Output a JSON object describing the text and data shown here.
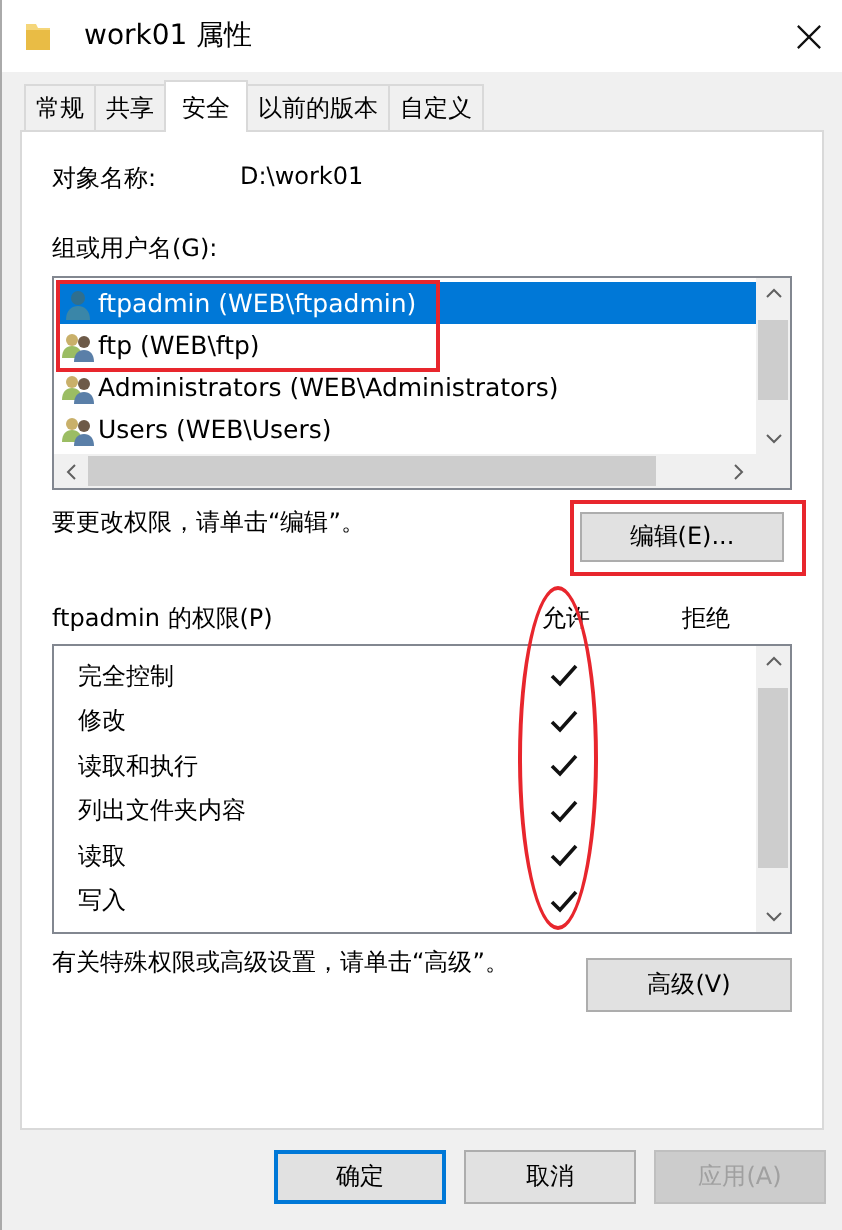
{
  "window": {
    "title": "work01 属性"
  },
  "tabs": [
    {
      "label": "常规",
      "selected": false
    },
    {
      "label": "共享",
      "selected": false
    },
    {
      "label": "安全",
      "selected": true
    },
    {
      "label": "以前的版本",
      "selected": false
    },
    {
      "label": "自定义",
      "selected": false
    }
  ],
  "object_name": {
    "label": "对象名称:",
    "value": "D:\\work01"
  },
  "users": {
    "label": "组或用户名(G):",
    "items": [
      {
        "name": "ftpadmin (WEB\\ftpadmin)",
        "kind": "user",
        "selected": true,
        "circled": true
      },
      {
        "name": "ftp (WEB\\ftp)",
        "kind": "group",
        "selected": false,
        "circled": true
      },
      {
        "name": "Administrators (WEB\\Administrators)",
        "kind": "group",
        "selected": false,
        "circled": false
      },
      {
        "name": "Users (WEB\\Users)",
        "kind": "group",
        "selected": false,
        "circled": false
      }
    ]
  },
  "edit_hint": "要更改权限，请单击“编辑”。",
  "edit_button": {
    "label": "编辑(E)...",
    "circled": true
  },
  "permissions": {
    "label": "ftpadmin 的权限(P)",
    "allow_header": "允许",
    "deny_header": "拒绝",
    "allow_column_circled": true,
    "items": [
      {
        "name": "完全控制",
        "allow": true,
        "deny": false
      },
      {
        "name": "修改",
        "allow": true,
        "deny": false
      },
      {
        "name": "读取和执行",
        "allow": true,
        "deny": false
      },
      {
        "name": "列出文件夹内容",
        "allow": true,
        "deny": false
      },
      {
        "name": "读取",
        "allow": true,
        "deny": false
      },
      {
        "name": "写入",
        "allow": true,
        "deny": false
      }
    ]
  },
  "advanced_hint": "有关特殊权限或高级设置，请单击“高级”。",
  "advanced_button": {
    "label": "高级(V)"
  },
  "buttons": [
    {
      "label": "确定",
      "default": true,
      "disabled": false
    },
    {
      "label": "取消",
      "default": false,
      "disabled": false
    },
    {
      "label": "应用(A)",
      "default": false,
      "disabled": true
    }
  ]
}
